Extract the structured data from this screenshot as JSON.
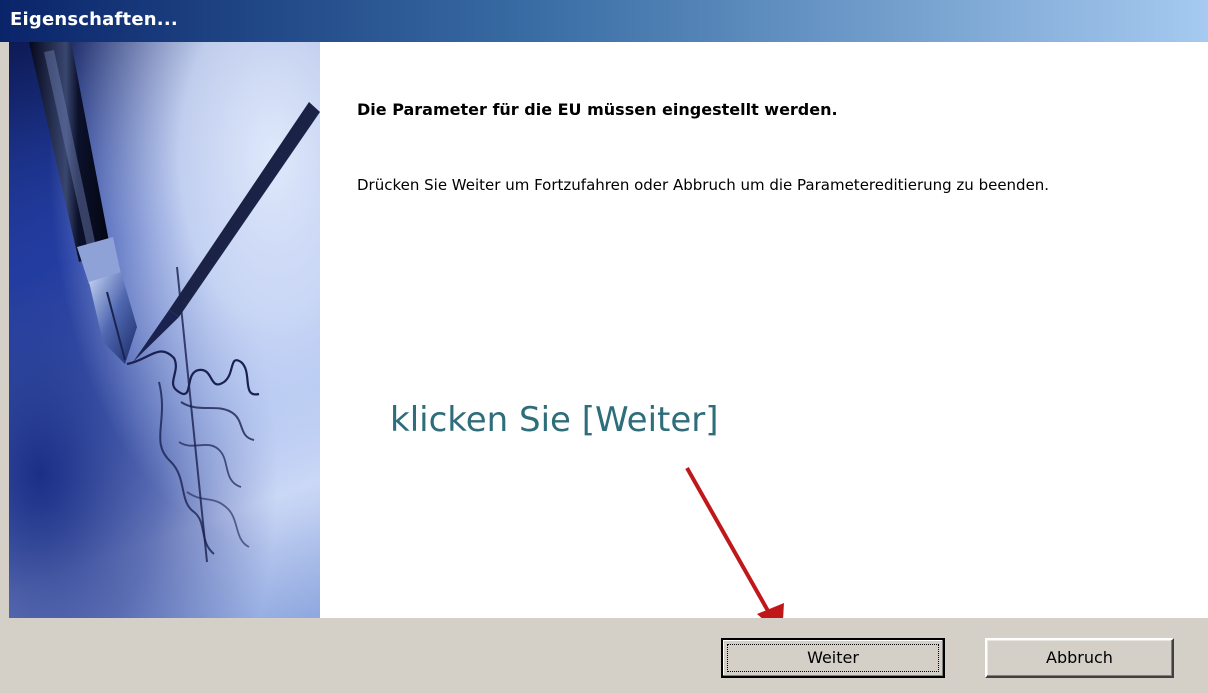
{
  "window": {
    "title": "Eigenschaften..."
  },
  "main": {
    "heading": "Die Parameter für die EU müssen eingestellt werden.",
    "instruction": "Drücken Sie Weiter um Fortzufahren oder Abbruch um die Parametereditierung zu beenden."
  },
  "annotation": {
    "text": "klicken Sie [Weiter]",
    "text_color": "#2e6d7a",
    "arrow_color": "#c0181a"
  },
  "buttons": {
    "next_label": "Weiter",
    "cancel_label": "Abbruch"
  },
  "side_image": {
    "icon": "fountain-pen-signature-image"
  },
  "colors": {
    "titlebar_start": "#0a246a",
    "titlebar_end": "#a6caf0",
    "dialog_face": "#d4d0c8"
  }
}
